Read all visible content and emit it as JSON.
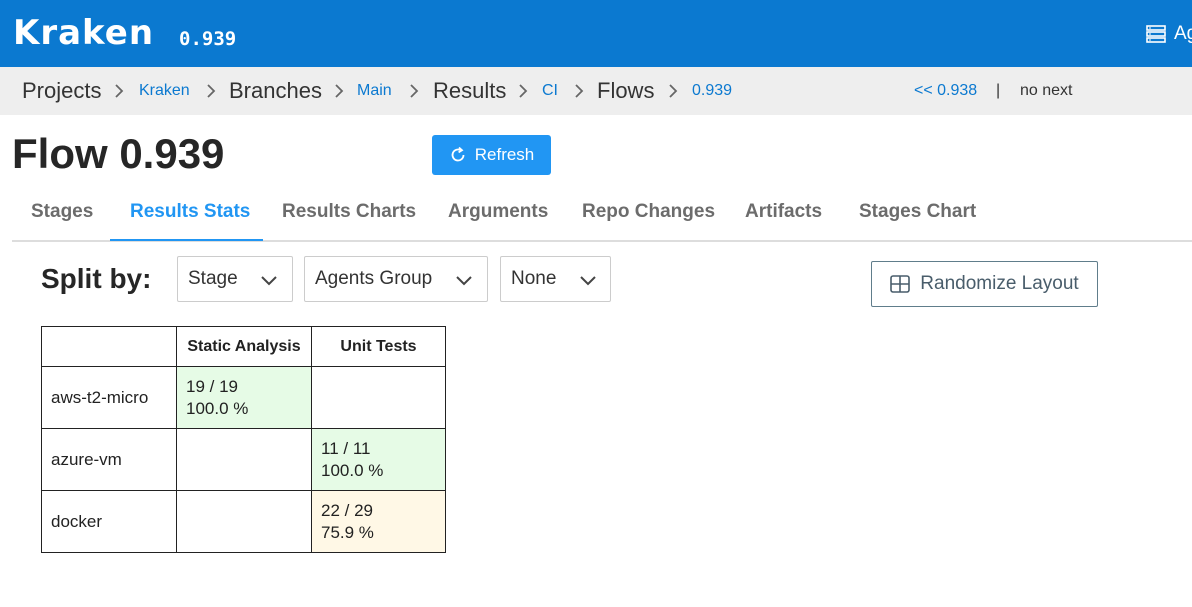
{
  "header": {
    "logo": "Kraken",
    "version": "0.939",
    "agents_label": "Agents",
    "agents_icon": "server-icon",
    "background": "#0b79d0"
  },
  "breadcrumb": {
    "items": [
      {
        "label": "Projects",
        "link": false
      },
      {
        "label": "Kraken",
        "link": true
      },
      {
        "label": "Branches",
        "link": false
      },
      {
        "label": "Main",
        "link": true
      },
      {
        "label": "Results",
        "link": false
      },
      {
        "label": "CI",
        "link": true
      },
      {
        "label": "Flows",
        "link": false
      },
      {
        "label": "0.939",
        "link": true
      }
    ],
    "prev_label": "<< 0.938",
    "separator": "|",
    "next_label": "no next"
  },
  "page": {
    "title": "Flow 0.939",
    "refresh_label": "Refresh",
    "accent": "#2196f3"
  },
  "tabs": [
    {
      "label": "Stages",
      "active": false
    },
    {
      "label": "Results Stats",
      "active": true
    },
    {
      "label": "Results Charts",
      "active": false
    },
    {
      "label": "Arguments",
      "active": false
    },
    {
      "label": "Repo Changes",
      "active": false
    },
    {
      "label": "Artifacts",
      "active": false
    },
    {
      "label": "Stages Chart",
      "active": false
    }
  ],
  "split": {
    "label": "Split by:",
    "dropdowns": [
      {
        "value": "Stage"
      },
      {
        "value": "Agents Group"
      },
      {
        "value": "None"
      }
    ],
    "randomize_label": "Randomize Layout"
  },
  "stats_table": {
    "columns": [
      "",
      "Static Analysis",
      "Unit Tests"
    ],
    "rows": [
      {
        "name": "aws-t2-micro",
        "cells": [
          {
            "count": "19 / 19",
            "percent": "100.0 %",
            "status": "green"
          },
          {
            "count": "",
            "percent": "",
            "status": "empty"
          }
        ]
      },
      {
        "name": "azure-vm",
        "cells": [
          {
            "count": "",
            "percent": "",
            "status": "empty"
          },
          {
            "count": "11 / 11",
            "percent": "100.0 %",
            "status": "green"
          }
        ]
      },
      {
        "name": "docker",
        "cells": [
          {
            "count": "",
            "percent": "",
            "status": "empty"
          },
          {
            "count": "22 / 29",
            "percent": "75.9 %",
            "status": "yellow"
          }
        ]
      }
    ],
    "colors": {
      "green": "#e6fbe6",
      "yellow": "#fff8e6"
    }
  }
}
